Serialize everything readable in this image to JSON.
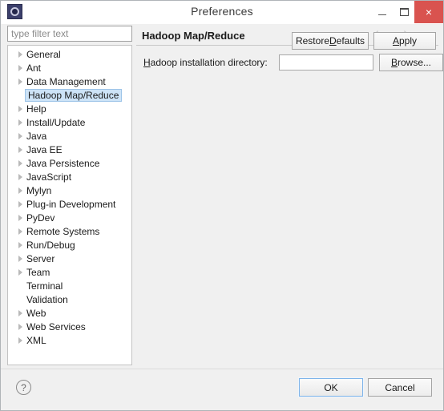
{
  "window": {
    "title": "Preferences",
    "icon": "eclipse-app-icon",
    "controls": {
      "minimize": "minimize-icon",
      "maximize": "maximize-icon",
      "close": "close-icon",
      "close_glyph": "×",
      "close_color": "#d9534f"
    }
  },
  "sidebar": {
    "filter": {
      "value": "",
      "placeholder": "type filter text"
    },
    "selected": "Hadoop Map/Reduce",
    "selection_color": "#cde3f7",
    "items": [
      {
        "label": "General",
        "expandable": true,
        "selected": false
      },
      {
        "label": "Ant",
        "expandable": true,
        "selected": false
      },
      {
        "label": "Data Management",
        "expandable": true,
        "selected": false
      },
      {
        "label": "Hadoop Map/Reduce",
        "expandable": false,
        "selected": true
      },
      {
        "label": "Help",
        "expandable": true,
        "selected": false
      },
      {
        "label": "Install/Update",
        "expandable": true,
        "selected": false
      },
      {
        "label": "Java",
        "expandable": true,
        "selected": false
      },
      {
        "label": "Java EE",
        "expandable": true,
        "selected": false
      },
      {
        "label": "Java Persistence",
        "expandable": true,
        "selected": false
      },
      {
        "label": "JavaScript",
        "expandable": true,
        "selected": false
      },
      {
        "label": "Mylyn",
        "expandable": true,
        "selected": false
      },
      {
        "label": "Plug-in Development",
        "expandable": true,
        "selected": false
      },
      {
        "label": "PyDev",
        "expandable": true,
        "selected": false
      },
      {
        "label": "Remote Systems",
        "expandable": true,
        "selected": false
      },
      {
        "label": "Run/Debug",
        "expandable": true,
        "selected": false
      },
      {
        "label": "Server",
        "expandable": true,
        "selected": false
      },
      {
        "label": "Team",
        "expandable": true,
        "selected": false
      },
      {
        "label": "Terminal",
        "expandable": false,
        "selected": false
      },
      {
        "label": "Validation",
        "expandable": false,
        "selected": false
      },
      {
        "label": "Web",
        "expandable": true,
        "selected": false
      },
      {
        "label": "Web Services",
        "expandable": true,
        "selected": false
      },
      {
        "label": "XML",
        "expandable": true,
        "selected": false
      }
    ]
  },
  "page": {
    "title": "Hadoop Map/Reduce",
    "nav": {
      "back": "back-arrow-icon",
      "back_menu": "chevron-down-icon",
      "forward": "forward-arrow-icon",
      "forward_menu": "chevron-down-icon",
      "view_menu": "view-menu-icon"
    },
    "field": {
      "label_mnemonic": "H",
      "label_rest": "adoop installation directory:",
      "value": "",
      "placeholder": ""
    },
    "browse_button": {
      "mnemonic": "B",
      "rest": "rowse..."
    },
    "restore_defaults_button": {
      "pre": "Restore ",
      "mnemonic": "D",
      "rest": "efaults"
    },
    "apply_button": {
      "mnemonic": "A",
      "rest": "pply"
    }
  },
  "footer": {
    "help_icon": "help-icon",
    "help_glyph": "?",
    "ok_label": "OK",
    "cancel_label": "Cancel",
    "default_button": "OK",
    "focus_color": "#7eb4ea"
  }
}
